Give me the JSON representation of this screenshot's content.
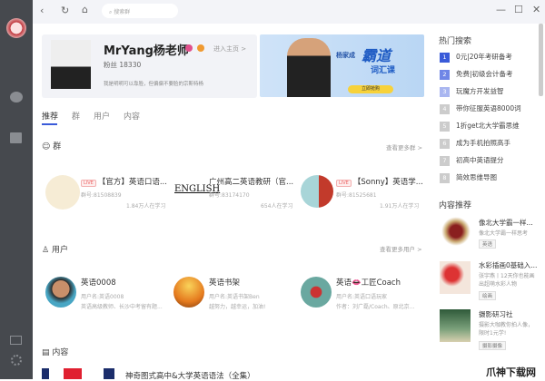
{
  "toolbar": {
    "search_placeholder": "搜索群"
  },
  "profile": {
    "name": "MrYang杨老师",
    "fans": "粉丝 18330",
    "enter": "进入主页 >",
    "bio": "我是明明可以靠脸，但偏偏不要脸的宗斯特杨"
  },
  "banner": {
    "name": "杨家成",
    "title": "霸道",
    "subtitle": "词汇课",
    "cta": "立即抢购"
  },
  "tabs": [
    "推荐",
    "群",
    "用户",
    "内容"
  ],
  "groups": {
    "title": "群",
    "more": "查看更多群 >",
    "items": [
      {
        "live": "LIVE",
        "name": "【官方】英语口语...",
        "id": "群号:81508839",
        "count": "1.84万人在学习"
      },
      {
        "live": "",
        "name": "广州高二英语教研（官...",
        "id": "群号:83174170",
        "count": "654人在学习",
        "logo": "ENGLISH"
      },
      {
        "live": "LIVE",
        "name": "【Sonny】英语学...",
        "id": "群号:81525681",
        "count": "1.91万人在学习"
      }
    ]
  },
  "users": {
    "title": "用户",
    "more": "查看更多用户 >",
    "items": [
      {
        "name": "英语0008",
        "username": "用户名:英语0008",
        "desc": "英语高级教师、长沙中考留有题..."
      },
      {
        "name": "英语书架",
        "username": "用户名:英语书架Ben",
        "desc": "越努力，越幸运，加油!"
      },
      {
        "name": "英语👄工匠Coach",
        "username": "用户名:英语口语玩家",
        "desc": "作者：刘广磊/Coach、原北京..."
      }
    ]
  },
  "content": {
    "title": "内容",
    "first_title": "神奇图式高中&大学英语语法（全集）"
  },
  "hot_search": {
    "title": "热门搜索",
    "items": [
      "0元|20年考研备考",
      "免费|初级会计备考",
      "玩魔方开发益智",
      "带你征服英语8000词",
      "1折get北大学霸思维",
      "成为手机拍照高手",
      "初高中英语提分",
      "简效思维导图"
    ],
    "colors": [
      "#3a5bd9",
      "#6f86e6",
      "#a9b6f0",
      "#ccc",
      "#ccc",
      "#ccc",
      "#ccc",
      "#ccc"
    ]
  },
  "recommend": {
    "title": "内容推荐",
    "items": [
      {
        "title": "像北大学霸一样...",
        "desc": "像北大学霸一样思考",
        "tag": "英语"
      },
      {
        "title": "水彩插画0基础入...",
        "desc": "张宇燕丨12天你也能画出超萌水彩人物",
        "tag": "绘画"
      },
      {
        "title": "摄影研习社",
        "desc": "摄影大咖教你拍人像，限时1元学!",
        "tag": "摄影摄像"
      }
    ]
  },
  "watermark": "爪神下载网"
}
